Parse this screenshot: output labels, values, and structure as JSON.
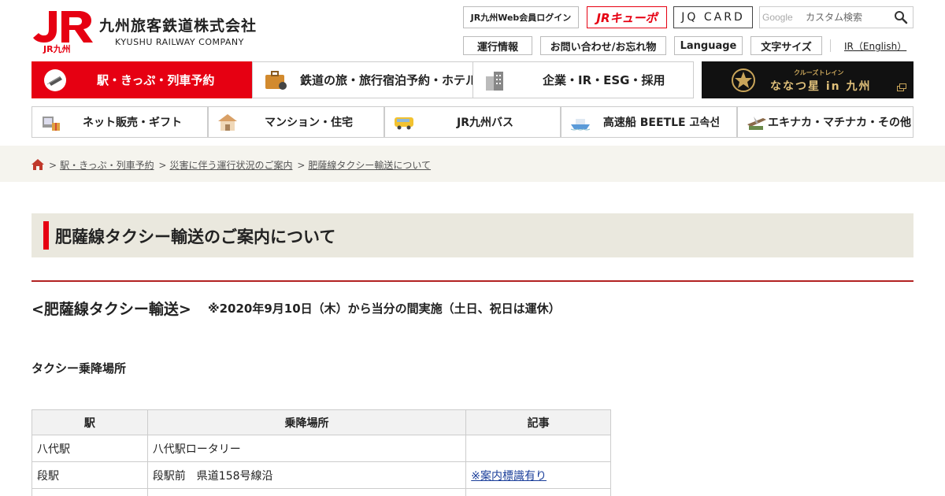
{
  "header": {
    "logo_mark": "JR",
    "logo_sub": "JR九州",
    "company_name": "九州旅客鉄道株式会社",
    "company_name_en": "KYUSHU RAILWAY COMPANY",
    "login_button": "JR九州Web会員ログイン",
    "kyupo_button": "JRキューポ",
    "jqcard_button": "JQ CARD",
    "search": {
      "provider_label": "Google",
      "placeholder": "カスタム検索"
    },
    "sub_links": {
      "unko": "運行情報",
      "inquiry": "お問い合わせ/お忘れ物",
      "language": "Language",
      "font_size": "文字サイズ",
      "ir_english": "IR（English）"
    }
  },
  "nav_primary": [
    {
      "label": "駅・きっぷ・列車予約"
    },
    {
      "label": "鉄道の旅・旅行宿泊予約・ホテル"
    },
    {
      "label": "企業・IR・ESG・採用"
    }
  ],
  "nanatsuboshi": {
    "small_label": "クルーズトレイン",
    "title": "ななつ星 in 九州"
  },
  "nav_secondary": [
    {
      "label": "ネット販売・ギフト"
    },
    {
      "label": "マンション・住宅"
    },
    {
      "label": "JR九州バス"
    },
    {
      "label": "高速船 BEETLE 고속선"
    },
    {
      "label": "エキナカ・マチナカ・その他"
    }
  ],
  "breadcrumb": {
    "items": [
      "駅・きっぷ・列車予約",
      "災害に伴う運行状況のご案内",
      "肥薩線タクシー輸送について"
    ],
    "separator": ">"
  },
  "page": {
    "title": "肥薩線タクシー輸送のご案内について",
    "section_heading": "<肥薩線タクシー輸送>",
    "section_note": "※2020年9月10日（木）から当分の間実施（土日、祝日は運休）",
    "subheading": "タクシー乗降場所"
  },
  "table": {
    "headers": [
      "駅",
      "乗降場所",
      "記事"
    ],
    "rows": [
      {
        "station": "八代駅",
        "place": "八代駅ロータリー",
        "note": ""
      },
      {
        "station": "段駅",
        "place": "段駅前　県道158号線沿",
        "note": "※案内標識有り"
      }
    ]
  },
  "colors": {
    "brand_red": "#e60012",
    "title_bg": "#eae8de",
    "breadcrumb_bg": "#f5f4ee",
    "link": "#1a3e9a"
  }
}
